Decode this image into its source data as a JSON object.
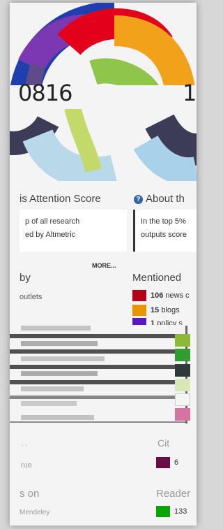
{
  "donut": {
    "score_left": "0816",
    "score_right": "1(",
    "colors": [
      "#1f3fae",
      "#e2001a",
      "#f2a11b",
      "#8fc54b",
      "#5f4b8b",
      "#b9d9eb",
      "#3c3c56",
      "#7c38b0"
    ]
  },
  "attention": {
    "heading": "is Attention Score",
    "box_line1": "p of all research",
    "box_line2": "ed by Altmetric",
    "more": "MORE..."
  },
  "about": {
    "heading": "About th",
    "box_line1": "In the top 5%",
    "box_line2": "outputs score"
  },
  "mentioned_by": {
    "left_heading": "by",
    "left_sub": "outlets",
    "right_heading": "Mentioned",
    "items": [
      {
        "count": "106",
        "label": "news c",
        "color": "#b3001b"
      },
      {
        "count": "15",
        "label": "blogs",
        "color": "#e89500"
      },
      {
        "count": "1",
        "label": "policy s",
        "color": "#5a16c8"
      }
    ]
  },
  "color_bars": [
    "#8db935",
    "#2e9e2e",
    "#2f3a3a",
    "#d7e8b4",
    "#f5f5f5",
    "#d673a0"
  ],
  "lower": {
    "left_faded": "rue",
    "right_faded": "Cit",
    "citations_value": "6",
    "citations_color": "#6a0f45",
    "readers_left": "s on",
    "readers_sub": "Mendeley",
    "readers_right": "Reader",
    "readers_value": "133",
    "readers_color": "#0aa500"
  }
}
